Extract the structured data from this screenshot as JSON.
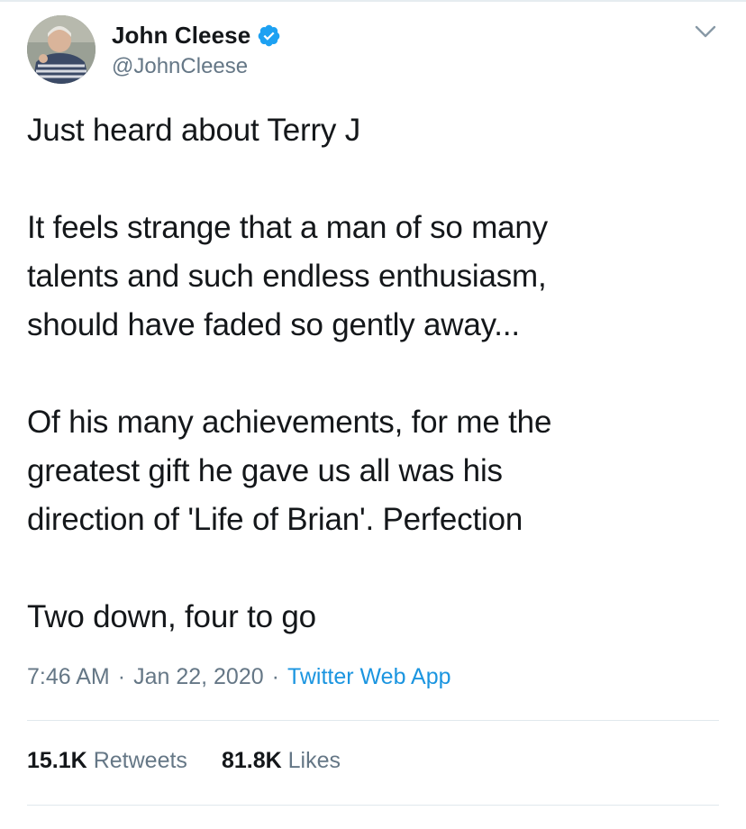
{
  "tweet": {
    "author": {
      "display_name": "John Cleese",
      "handle": "@JohnCleese",
      "verified": true,
      "avatar_icon": "profile-photo"
    },
    "text": "Just heard about Terry J\n\nIt feels strange that a man of so many\ntalents and such endless enthusiasm,\nshould have faded so gently away...\n\nOf his many achievements, for me the\ngreatest gift he gave us all was his\ndirection of 'Life of Brian'. Perfection\n\nTwo down, four to go",
    "time": "7:46 AM",
    "separator": "·",
    "date": "Jan 22, 2020",
    "source": "Twitter Web App",
    "stats": {
      "retweets_count": "15.1K",
      "retweets_label": "Retweets",
      "likes_count": "81.8K",
      "likes_label": "Likes"
    }
  },
  "colors": {
    "text": "#14171a",
    "secondary": "#657786",
    "link": "#1b95e0",
    "verified_badge": "#1da1f2",
    "divider": "#e1e8ed"
  }
}
